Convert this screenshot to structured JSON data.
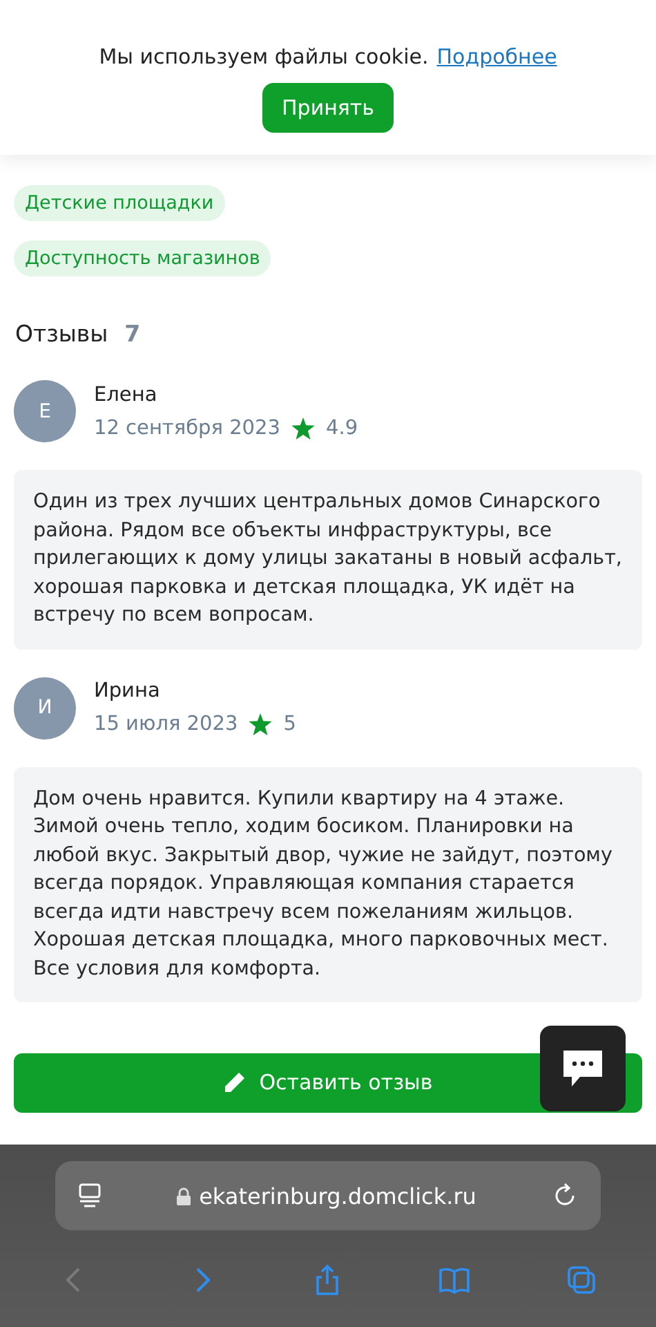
{
  "cookie_banner": {
    "text": "Мы используем файлы cookie.",
    "link": "Подробнее",
    "button": "Принять"
  },
  "tags": [
    "Детские площадки",
    "Доступность магазинов"
  ],
  "reviews_header": {
    "title": "Отзывы",
    "count": "7"
  },
  "reviews": [
    {
      "initial": "Е",
      "name": "Елена",
      "date": "12 сентября 2023",
      "rating": "4.9",
      "text": "Один из трех лучших центральных домов Синарского района. Рядом все объекты инфраструктуры, все прилегающих к дому улицы закатаны в новый асфальт, хорошая парковка и детская площадка, УК идёт на встречу по всем вопросам."
    },
    {
      "initial": "И",
      "name": "Ирина",
      "date": "15 июля 2023",
      "rating": "5",
      "text": "Дом очень нравится. Купили квартиру на 4 этаже. Зимой очень тепло, ходим босиком. Планировки на любой вкус. Закрытый двор, чужие не зайдут, поэтому всегда порядок. Управляющая компания старается всегда идти навстречу всем пожеланиям жильцов. Хорошая детская площадка, много парковочных мест. Все условия для комфорта."
    }
  ],
  "leave_review_button": "Оставить отзыв",
  "browser": {
    "url": "ekaterinburg.domclick.ru",
    "toolbar": [
      {
        "kind": "back",
        "disabled": true
      },
      {
        "kind": "forward",
        "disabled": false
      },
      {
        "kind": "share",
        "disabled": false
      },
      {
        "kind": "bookmarks",
        "disabled": false
      },
      {
        "kind": "tabs",
        "disabled": false
      }
    ]
  }
}
